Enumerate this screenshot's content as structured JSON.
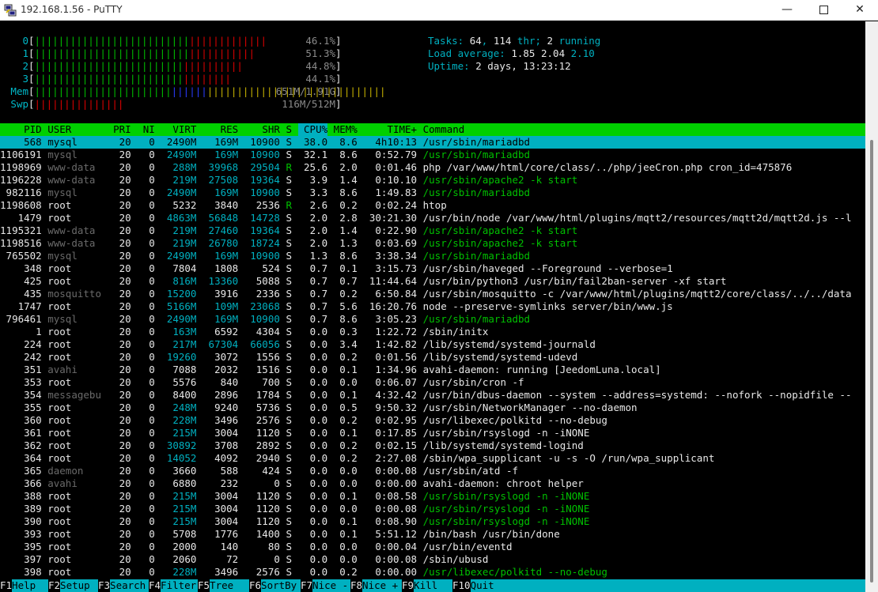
{
  "window": {
    "title": "192.168.1.56 - PuTTY",
    "app_icon": "putty-icon"
  },
  "meters": [
    {
      "label": "0",
      "value": "46.1%",
      "bars": [
        {
          "color": "g",
          "n": 26
        },
        {
          "color": "r",
          "n": 13
        }
      ]
    },
    {
      "label": "1",
      "value": "51.3%",
      "bars": [
        {
          "color": "g",
          "n": 26
        },
        {
          "color": "r",
          "n": 11
        }
      ]
    },
    {
      "label": "2",
      "value": "44.8%",
      "bars": [
        {
          "color": "g",
          "n": 25
        },
        {
          "color": "r",
          "n": 10
        }
      ]
    },
    {
      "label": "3",
      "value": "44.1%",
      "bars": [
        {
          "color": "g",
          "n": 25
        },
        {
          "color": "r",
          "n": 8
        }
      ]
    },
    {
      "label": "Mem",
      "value": "651M/1.91G",
      "bars": [
        {
          "color": "g",
          "n": 23
        },
        {
          "color": "b",
          "n": 6
        },
        {
          "color": "y",
          "n": 30
        }
      ]
    },
    {
      "label": "Swp",
      "value": "116M/512M",
      "bars": [
        {
          "color": "r",
          "n": 15
        }
      ]
    }
  ],
  "tasks": {
    "label": "Tasks: ",
    "count": "64",
    "sep1": ", ",
    "threads": "114",
    "thr_label": " thr; ",
    "running": "2",
    "running_label": " running"
  },
  "load": {
    "label": "Load average: ",
    "v1": "1.85",
    "v2": "2.04",
    "v3": "2.10"
  },
  "uptime": {
    "label": "Uptime: ",
    "value": "2 days, 13:23:12"
  },
  "columns": [
    "PID",
    "USER",
    "PRI",
    "NI",
    "VIRT",
    "RES",
    "SHR",
    "S",
    "CPU%",
    "MEM%",
    "TIME+",
    "Command"
  ],
  "processes": [
    [
      "568",
      "mysql",
      "20",
      "0",
      "2490M",
      "169M",
      "10900",
      "S",
      "38.0",
      "8.6",
      "4h10:13",
      "/usr/sbin/mariadbd",
      "sel"
    ],
    [
      "1106191",
      "mysql",
      "20",
      "0",
      "2490M",
      "169M",
      "10900",
      "S",
      "32.1",
      "8.6",
      "0:52.79",
      "/usr/sbin/mariadbd",
      "thr"
    ],
    [
      "1198969",
      "www-data",
      "20",
      "0",
      "288M",
      "39968",
      "29504",
      "R",
      "25.6",
      "2.0",
      "0:01.46",
      "php /var/www/html/core/class/../php/jeeCron.php cron_id=475876",
      "n"
    ],
    [
      "1196228",
      "www-data",
      "20",
      "0",
      "219M",
      "27508",
      "19364",
      "S",
      "3.9",
      "1.4",
      "0:10.10",
      "/usr/sbin/apache2 -k start",
      "thr"
    ],
    [
      "982116",
      "mysql",
      "20",
      "0",
      "2490M",
      "169M",
      "10900",
      "S",
      "3.3",
      "8.6",
      "1:49.83",
      "/usr/sbin/mariadbd",
      "thr"
    ],
    [
      "1198608",
      "root",
      "20",
      "0",
      "5232",
      "3840",
      "2536",
      "R",
      "2.6",
      "0.2",
      "0:02.24",
      "htop",
      "n"
    ],
    [
      "1479",
      "root",
      "20",
      "0",
      "4863M",
      "56848",
      "14728",
      "S",
      "2.0",
      "2.8",
      "30:21.30",
      "/usr/bin/node /var/www/html/plugins/mqtt2/resources/mqtt2d/mqtt2d.js --l",
      "n"
    ],
    [
      "1195321",
      "www-data",
      "20",
      "0",
      "219M",
      "27460",
      "19364",
      "S",
      "2.0",
      "1.4",
      "0:22.90",
      "/usr/sbin/apache2 -k start",
      "thr"
    ],
    [
      "1198516",
      "www-data",
      "20",
      "0",
      "219M",
      "26780",
      "18724",
      "S",
      "2.0",
      "1.3",
      "0:03.69",
      "/usr/sbin/apache2 -k start",
      "thr"
    ],
    [
      "765502",
      "mysql",
      "20",
      "0",
      "2490M",
      "169M",
      "10900",
      "S",
      "1.3",
      "8.6",
      "3:38.34",
      "/usr/sbin/mariadbd",
      "thr"
    ],
    [
      "348",
      "root",
      "20",
      "0",
      "7804",
      "1808",
      "524",
      "S",
      "0.7",
      "0.1",
      "3:15.73",
      "/usr/sbin/haveged --Foreground --verbose=1",
      "n"
    ],
    [
      "425",
      "root",
      "20",
      "0",
      "816M",
      "13360",
      "5088",
      "S",
      "0.7",
      "0.7",
      "11:44.64",
      "/usr/bin/python3 /usr/bin/fail2ban-server -xf start",
      "n"
    ],
    [
      "435",
      "mosquitto",
      "20",
      "0",
      "15200",
      "3916",
      "2336",
      "S",
      "0.7",
      "0.2",
      "6:50.84",
      "/usr/sbin/mosquitto -c /var/www/html/plugins/mqtt2/core/class/../../data",
      "n"
    ],
    [
      "1747",
      "root",
      "20",
      "0",
      "5166M",
      "109M",
      "23068",
      "S",
      "0.7",
      "5.6",
      "16:20.76",
      "node --preserve-symlinks server/bin/www.js",
      "n"
    ],
    [
      "796461",
      "mysql",
      "20",
      "0",
      "2490M",
      "169M",
      "10900",
      "S",
      "0.7",
      "8.6",
      "3:05.23",
      "/usr/sbin/mariadbd",
      "thr"
    ],
    [
      "1",
      "root",
      "20",
      "0",
      "163M",
      "6592",
      "4304",
      "S",
      "0.0",
      "0.3",
      "1:22.72",
      "/sbin/initx",
      "n"
    ],
    [
      "224",
      "root",
      "20",
      "0",
      "217M",
      "67304",
      "66056",
      "S",
      "0.0",
      "3.4",
      "1:42.82",
      "/lib/systemd/systemd-journald",
      "n"
    ],
    [
      "242",
      "root",
      "20",
      "0",
      "19260",
      "3072",
      "1556",
      "S",
      "0.0",
      "0.2",
      "0:01.56",
      "/lib/systemd/systemd-udevd",
      "n"
    ],
    [
      "351",
      "avahi",
      "20",
      "0",
      "7088",
      "2032",
      "1516",
      "S",
      "0.0",
      "0.1",
      "1:34.96",
      "avahi-daemon: running [JeedomLuna.local]",
      "n"
    ],
    [
      "353",
      "root",
      "20",
      "0",
      "5576",
      "840",
      "700",
      "S",
      "0.0",
      "0.0",
      "0:06.07",
      "/usr/sbin/cron -f",
      "n"
    ],
    [
      "354",
      "messagebu",
      "20",
      "0",
      "8400",
      "2896",
      "1784",
      "S",
      "0.0",
      "0.1",
      "4:32.42",
      "/usr/bin/dbus-daemon --system --address=systemd: --nofork --nopidfile --",
      "n"
    ],
    [
      "355",
      "root",
      "20",
      "0",
      "248M",
      "9240",
      "5736",
      "S",
      "0.0",
      "0.5",
      "9:50.32",
      "/usr/sbin/NetworkManager --no-daemon",
      "n"
    ],
    [
      "360",
      "root",
      "20",
      "0",
      "228M",
      "3496",
      "2576",
      "S",
      "0.0",
      "0.2",
      "0:02.95",
      "/usr/libexec/polkitd --no-debug",
      "n"
    ],
    [
      "361",
      "root",
      "20",
      "0",
      "215M",
      "3004",
      "1120",
      "S",
      "0.0",
      "0.1",
      "0:17.85",
      "/usr/sbin/rsyslogd -n -iNONE",
      "n"
    ],
    [
      "362",
      "root",
      "20",
      "0",
      "30892",
      "3708",
      "2892",
      "S",
      "0.0",
      "0.2",
      "0:02.15",
      "/lib/systemd/systemd-logind",
      "n"
    ],
    [
      "364",
      "root",
      "20",
      "0",
      "14052",
      "4092",
      "2940",
      "S",
      "0.0",
      "0.2",
      "2:27.08",
      "/sbin/wpa_supplicant -u -s -O /run/wpa_supplicant",
      "n"
    ],
    [
      "365",
      "daemon",
      "20",
      "0",
      "3660",
      "588",
      "424",
      "S",
      "0.0",
      "0.0",
      "0:00.08",
      "/usr/sbin/atd -f",
      "n"
    ],
    [
      "366",
      "avahi",
      "20",
      "0",
      "6880",
      "232",
      "0",
      "S",
      "0.0",
      "0.0",
      "0:00.00",
      "avahi-daemon: chroot helper",
      "n"
    ],
    [
      "388",
      "root",
      "20",
      "0",
      "215M",
      "3004",
      "1120",
      "S",
      "0.0",
      "0.1",
      "0:08.58",
      "/usr/sbin/rsyslogd -n -iNONE",
      "thr"
    ],
    [
      "389",
      "root",
      "20",
      "0",
      "215M",
      "3004",
      "1120",
      "S",
      "0.0",
      "0.0",
      "0:00.08",
      "/usr/sbin/rsyslogd -n -iNONE",
      "thr"
    ],
    [
      "390",
      "root",
      "20",
      "0",
      "215M",
      "3004",
      "1120",
      "S",
      "0.0",
      "0.1",
      "0:08.90",
      "/usr/sbin/rsyslogd -n -iNONE",
      "thr"
    ],
    [
      "393",
      "root",
      "20",
      "0",
      "5708",
      "1776",
      "1400",
      "S",
      "0.0",
      "0.1",
      "5:51.12",
      "/bin/bash /usr/bin/done",
      "n"
    ],
    [
      "395",
      "root",
      "20",
      "0",
      "2000",
      "140",
      "80",
      "S",
      "0.0",
      "0.0",
      "0:00.04",
      "/usr/bin/eventd",
      "n"
    ],
    [
      "397",
      "root",
      "20",
      "0",
      "2060",
      "72",
      "0",
      "S",
      "0.0",
      "0.0",
      "0:00.08",
      "/sbin/ubusd",
      "n"
    ],
    [
      "398",
      "root",
      "20",
      "0",
      "228M",
      "3496",
      "2576",
      "S",
      "0.0",
      "0.2",
      "0:00.00",
      "/usr/libexec/polkitd --no-debug",
      "thr"
    ]
  ],
  "fkeys": [
    {
      "key": "F1",
      "label": "Help"
    },
    {
      "key": "F2",
      "label": "Setup"
    },
    {
      "key": "F3",
      "label": "Search"
    },
    {
      "key": "F4",
      "label": "Filter"
    },
    {
      "key": "F5",
      "label": "Tree"
    },
    {
      "key": "F6",
      "label": "SortBy"
    },
    {
      "key": "F7",
      "label": "Nice -"
    },
    {
      "key": "F8",
      "label": "Nice +"
    },
    {
      "key": "F9",
      "label": "Kill"
    },
    {
      "key": "F10",
      "label": "Quit"
    }
  ]
}
